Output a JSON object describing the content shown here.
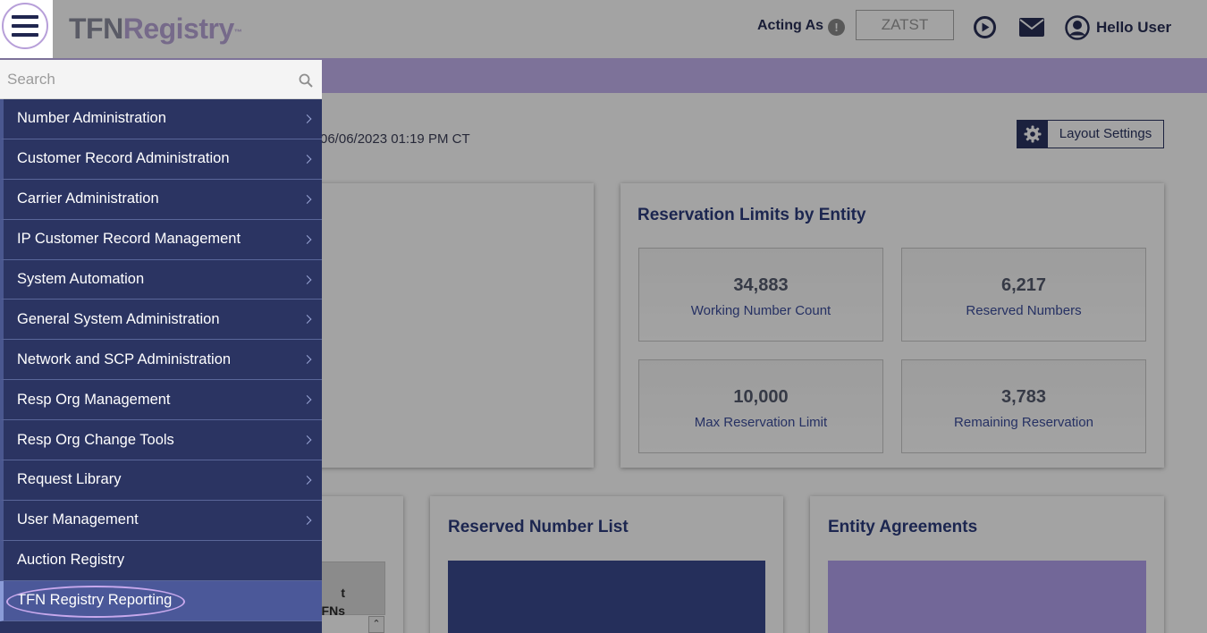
{
  "header": {
    "logo_tfn": "TFN",
    "logo_registry": "Registry",
    "logo_tm": "™",
    "acting_as_label": "Acting As",
    "info_icon_glyph": "!",
    "acting_as_value": "ZATST",
    "greeting": "Hello User",
    "icons": [
      "hamburger-menu-icon",
      "info-icon",
      "play-circle-icon",
      "mail-icon",
      "user-icon"
    ]
  },
  "main": {
    "timestamp": "06/06/2023 01:19 PM CT",
    "layout_settings_label": "Layout Settings",
    "reservation_card": {
      "title": "Reservation Limits by Entity",
      "stats": [
        {
          "value": "34,883",
          "label": "Working Number Count"
        },
        {
          "value": "6,217",
          "label": "Reserved Numbers"
        },
        {
          "value": "10,000",
          "label": "Max Reservation Limit"
        },
        {
          "value": "3,783",
          "label": "Remaining Reservation"
        }
      ]
    },
    "partial_table": {
      "header_line1": "d TFNs",
      "header_line2": "t",
      "scroll_glyph": "⌃"
    },
    "reserved_list_title": "Reserved Number List",
    "entity_agreements_title": "Entity Agreements"
  },
  "menu": {
    "search_placeholder": "Search",
    "items": [
      {
        "label": "Number Administration"
      },
      {
        "label": "Customer Record Administration"
      },
      {
        "label": "Carrier Administration"
      },
      {
        "label": "IP Customer Record Management"
      },
      {
        "label": "System Automation"
      },
      {
        "label": "General System Administration"
      },
      {
        "label": "Network and SCP Administration"
      },
      {
        "label": "Resp Org Management"
      },
      {
        "label": "Resp Org Change Tools"
      },
      {
        "label": "Request Library"
      },
      {
        "label": "User Management"
      },
      {
        "label": "Auction Registry"
      },
      {
        "label": "TFN Registry Reporting"
      }
    ]
  },
  "colors": {
    "brand_navy": "#2b3462",
    "brand_lavender": "#c4b3ef",
    "highlight_ring": "#c7a8ec"
  }
}
